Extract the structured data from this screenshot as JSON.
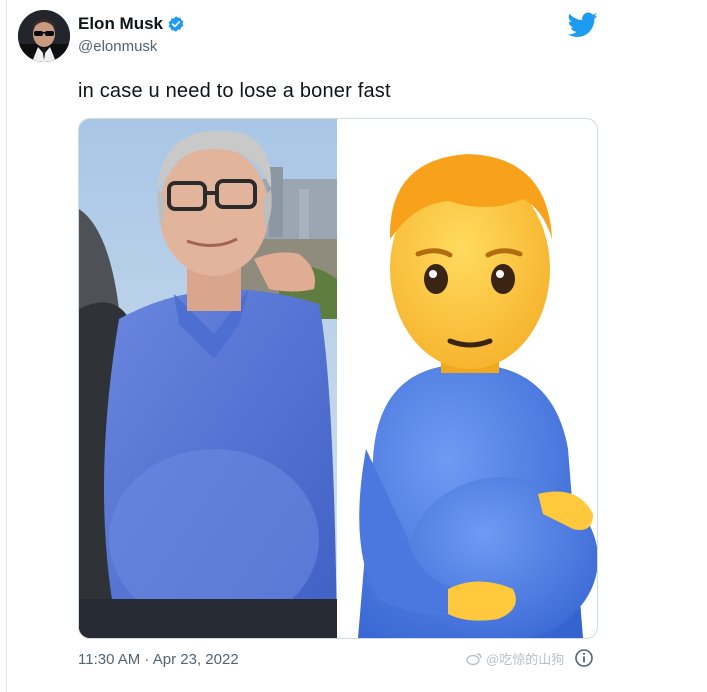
{
  "tweet": {
    "display_name": "Elon Musk",
    "handle": "@elonmusk",
    "text": "in case u need to lose a boner fast",
    "timestamp": "11:30 AM · Apr 23, 2022"
  },
  "watermark": {
    "text": "@吃惊的山狗"
  },
  "icons": {
    "verified": "verified-badge-icon",
    "logo": "twitter-bird-icon",
    "info": "info-icon"
  },
  "colors": {
    "brand_blue": "#1d9bf0",
    "text_primary": "#0f1419",
    "text_secondary": "#536471",
    "shirt_blue": "#5b7fe0"
  }
}
